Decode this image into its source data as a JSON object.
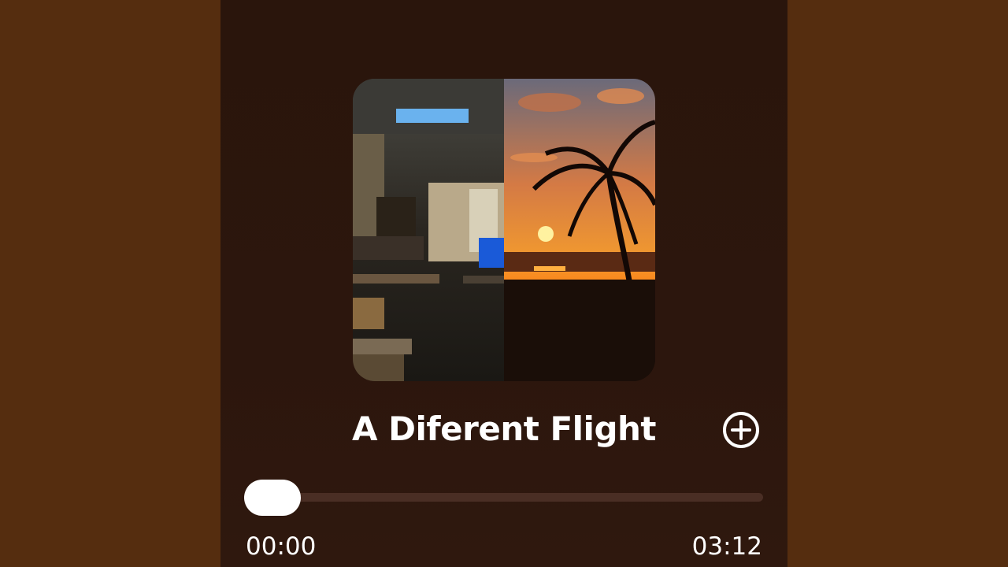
{
  "player": {
    "title": "A Diferent Flight",
    "add_icon": "plus-circle-icon",
    "elapsed": "00:00",
    "duration": "03:12",
    "progress": 0.0
  },
  "colors": {
    "sides": "#552d0f",
    "panel": "#2a150c",
    "track": "#4a2e24",
    "thumb": "#ffffff"
  }
}
